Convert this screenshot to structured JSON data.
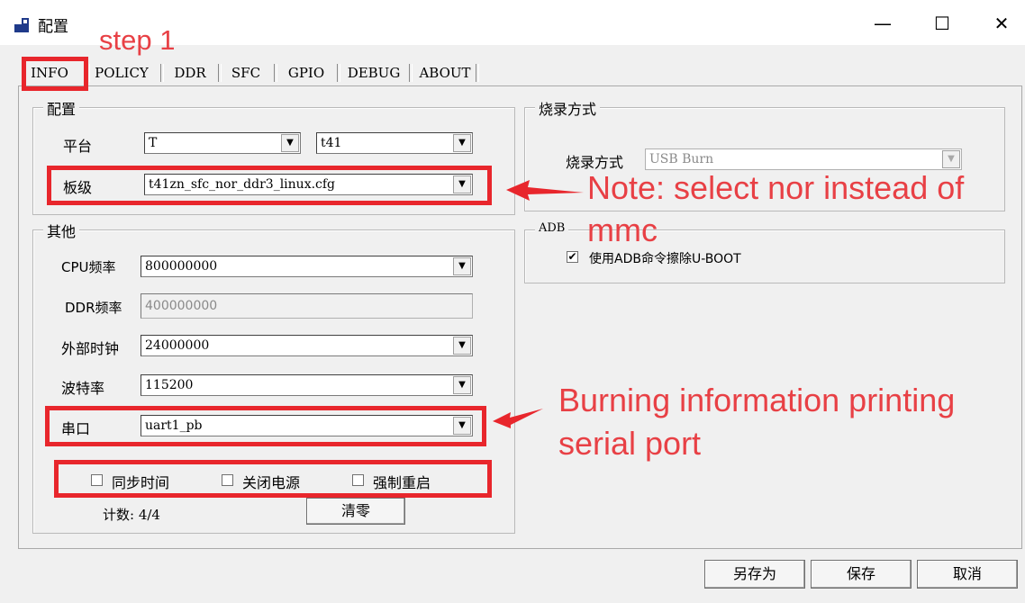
{
  "window": {
    "title": "配置",
    "minimize": "—",
    "maximize": "☐",
    "close": "✕"
  },
  "tabs": [
    {
      "label": "INFO",
      "active": true
    },
    {
      "label": "POLICY"
    },
    {
      "label": "DDR"
    },
    {
      "label": "SFC"
    },
    {
      "label": "GPIO"
    },
    {
      "label": "DEBUG"
    },
    {
      "label": "ABOUT"
    }
  ],
  "config_group": {
    "title": "配置",
    "platform_label": "平台",
    "platform_value": "T",
    "chip_value": "t41",
    "board_label": "板级",
    "board_value": "t41zn_sfc_nor_ddr3_linux.cfg"
  },
  "other_group": {
    "title": "其他",
    "cpu_freq_label": "CPU频率",
    "cpu_freq_value": "800000000",
    "ddr_freq_label": "DDR频率",
    "ddr_freq_value": "400000000",
    "ext_clock_label": "外部时钟",
    "ext_clock_value": "24000000",
    "baud_label": "波特率",
    "baud_value": "115200",
    "serial_label": "串口",
    "serial_value": "uart1_pb",
    "sync_time_label": "同步时间",
    "power_off_label": "关闭电源",
    "force_reboot_label": "强制重启",
    "count_text": "计数: 4/4",
    "clear_button": "清零"
  },
  "burn_group": {
    "title": "烧录方式",
    "mode_label": "烧录方式",
    "mode_value": "USB Burn"
  },
  "adb_group": {
    "title": "ADB",
    "erase_label": "使用ADB命令擦除U-BOOT",
    "erase_checked": true,
    "check_mark": "✔"
  },
  "footer": {
    "save_as": "另存为",
    "save": "保存",
    "cancel": "取消"
  },
  "annotations": {
    "step": "step 1",
    "note_line1": "Note: select nor instead of",
    "note_line2": "mmc",
    "burn_line1": "Burning information printing",
    "burn_line2": "serial port"
  },
  "colors": {
    "annotation_red": "#e8262c"
  }
}
